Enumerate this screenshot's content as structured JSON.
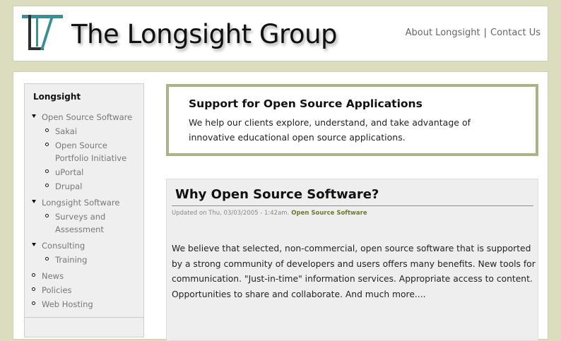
{
  "header": {
    "site_title": "The Longsight Group",
    "links": {
      "about": "About Longsight",
      "separator": "|",
      "contact": "Contact Us"
    }
  },
  "sidebar": {
    "title": "Longsight",
    "items": [
      {
        "label": "Open Source Software",
        "type": "expanded"
      },
      {
        "label": "Sakai",
        "type": "child"
      },
      {
        "label": "Open Source",
        "type": "child"
      },
      {
        "label": "Portfolio Initiative",
        "type": "child-cont"
      },
      {
        "label": "uPortal",
        "type": "child"
      },
      {
        "label": "Drupal",
        "type": "child"
      },
      {
        "label": "Longsight Software",
        "type": "expanded"
      },
      {
        "label": "Surveys and",
        "type": "child"
      },
      {
        "label": "Assessment",
        "type": "child-cont"
      },
      {
        "label": "Consulting",
        "type": "expanded"
      },
      {
        "label": "Training",
        "type": "child"
      },
      {
        "label": "News",
        "type": "leaf"
      },
      {
        "label": "Policies",
        "type": "leaf"
      },
      {
        "label": "Web Hosting",
        "type": "leaf"
      }
    ]
  },
  "support": {
    "title": "Support for Open Source Applications",
    "text": "We help our clients explore, understand, and take advantage of innovative educational open source applications."
  },
  "article": {
    "title": "Why Open Source Software?",
    "meta": "Updated on Thu, 03/03/2005 - 1:42am.",
    "tag": "Open Source Software",
    "body": "We believe that selected, non-commercial, open source software that is supported by a strong community of developers and users offers many benefits. New tools for communication. \"Just-in-time\" information services. Appropriate access to content. Opportunities to share and collaborate. And much more...."
  }
}
